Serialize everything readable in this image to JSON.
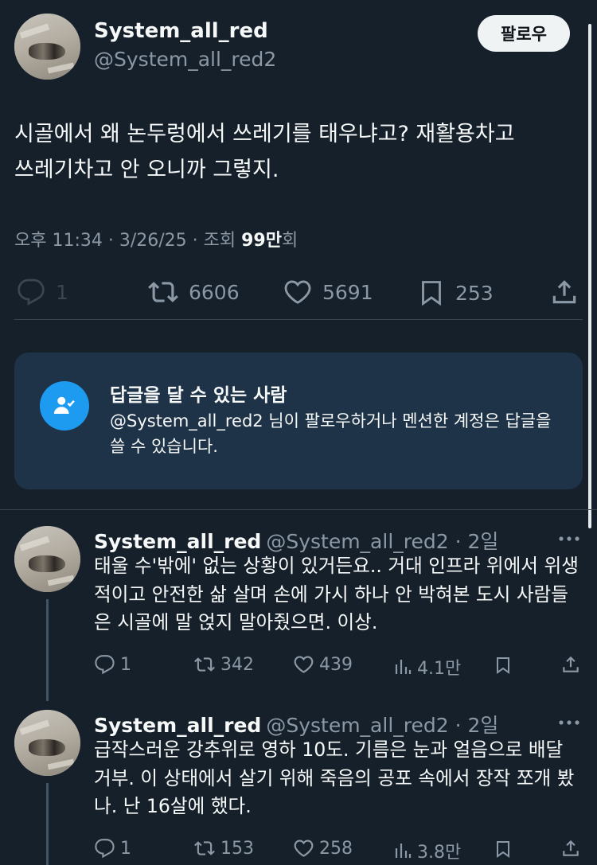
{
  "tweet": {
    "author_name": "System_all_red",
    "author_handle": "@System_all_red2",
    "follow_label": "팔로우",
    "text_line1": "시골에서 왜 논두렁에서 쓰레기를 태우냐고? 재활용차고",
    "text_line2": "쓰레기차고 안 오니까 그렇지.",
    "time": "오후 11:34 · 3/26/25 · 조회 ",
    "views": "99만",
    "views_suffix": "회",
    "replies": "1",
    "retweets": "6606",
    "likes": "5691",
    "bookmarks": "253"
  },
  "reply_restriction": {
    "title": "답글을 달 수 있는 사람",
    "description": "@System_all_red2 님이 팔로우하거나 멘션한 계정은 답글을 쓸 수 있습니다."
  },
  "replies": [
    {
      "name": "System_all_red",
      "handle": "@System_all_red2 · 2일",
      "text": "태울 수'밖에' 없는 상황이 있거든요.. 거대 인프라 위에서 위생적이고 안전한 삶 살며 손에 가시 하나 안 박혀본 도시 사람들은 시골에 말 얹지 말아줬으면. 이상.",
      "replies": "1",
      "retweets": "342",
      "likes": "439",
      "views": "4.1만"
    },
    {
      "name": "System_all_red",
      "handle": "@System_all_red2 · 2일",
      "text": "급작스러운 강추위로 영하 10도. 기름은 눈과 얼음으로 배달 거부. 이 상태에서 살기 위해 죽음의 공포 속에서 장작 쪼개 봤나. 난 16살에 했다.",
      "replies": "1",
      "retweets": "153",
      "likes": "258",
      "views": "3.8만"
    }
  ],
  "icons": {
    "reply": "reply-icon",
    "retweet": "retweet-icon",
    "like": "heart-icon",
    "bookmark": "bookmark-icon",
    "share": "share-icon",
    "views": "views-icon",
    "more": "more-icon"
  },
  "colors": {
    "background": "#15202b",
    "accent": "#1d9bf0",
    "secondary_text": "#8b98a5"
  }
}
